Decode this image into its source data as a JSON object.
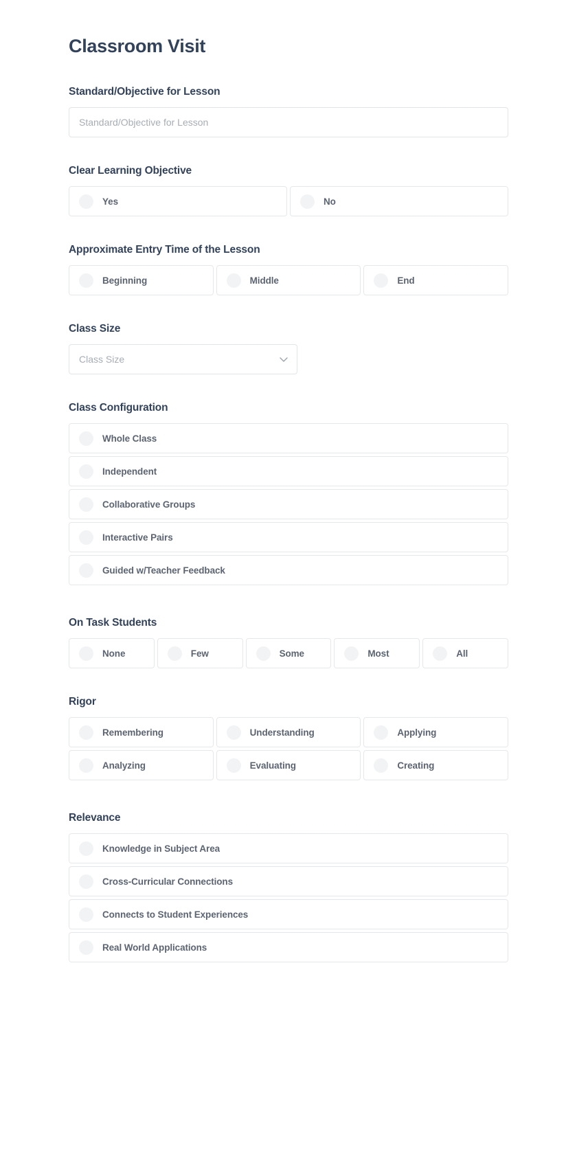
{
  "form": {
    "title": "Classroom Visit",
    "sections": [
      {
        "id": "standard_objective",
        "label": "Standard/Objective for Lesson",
        "type": "text",
        "value": "",
        "placeholder": "Standard/Objective for Lesson"
      },
      {
        "id": "clear_learning_objective",
        "label": "Clear Learning Objective",
        "type": "radio-row-2",
        "options": [
          "Yes",
          "No"
        ]
      },
      {
        "id": "entry_time",
        "label": "Approximate Entry Time of the Lesson",
        "type": "radio-row-3",
        "options": [
          "Beginning",
          "Middle",
          "End"
        ]
      },
      {
        "id": "class_size",
        "label": "Class Size",
        "type": "select",
        "value": "",
        "placeholder": "Class Size",
        "icon": "chevron-down-icon"
      },
      {
        "id": "class_configuration",
        "label": "Class Configuration",
        "type": "radio-stack",
        "options": [
          "Whole Class",
          "Independent",
          "Collaborative Groups",
          "Interactive Pairs",
          "Guided w/Teacher Feedback"
        ]
      },
      {
        "id": "on_task_students",
        "label": "On Task Students",
        "type": "radio-row-5",
        "options": [
          "None",
          "Few",
          "Some",
          "Most",
          "All"
        ]
      },
      {
        "id": "rigor",
        "label": "Rigor",
        "type": "radio-grid-3",
        "options": [
          "Remembering",
          "Understanding",
          "Applying",
          "Analyzing",
          "Evaluating",
          "Creating"
        ]
      },
      {
        "id": "relevance",
        "label": "Relevance",
        "type": "radio-stack",
        "options": [
          "Knowledge in Subject Area",
          "Cross-Curricular Connections",
          "Connects to Student Experiences",
          "Real World Applications"
        ]
      }
    ]
  },
  "colors": {
    "title": "#32425a",
    "label": "#32425a",
    "option_text": "#5c6472",
    "placeholder": "#a7adb5",
    "border": "#e2e5e8",
    "radio_fill": "#f2f3f5",
    "background": "#ffffff"
  }
}
